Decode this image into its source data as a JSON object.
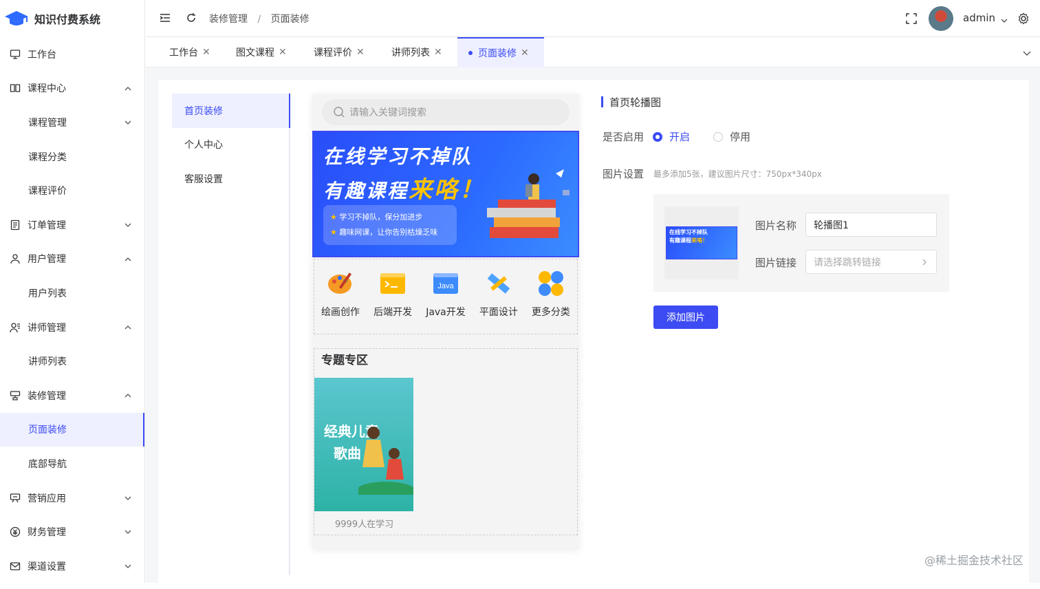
{
  "app": {
    "title": "知识付费系统"
  },
  "sidebar": {
    "items": [
      {
        "label": "工作台",
        "icon": "monitor-icon",
        "type": "top"
      },
      {
        "label": "课程中心",
        "icon": "book-icon",
        "type": "top",
        "arrow": "up"
      },
      {
        "label": "课程管理",
        "type": "sub",
        "arrow": "down"
      },
      {
        "label": "课程分类",
        "type": "sub"
      },
      {
        "label": "课程评价",
        "type": "sub"
      },
      {
        "label": "订单管理",
        "icon": "order-icon",
        "type": "top",
        "arrow": "down"
      },
      {
        "label": "用户管理",
        "icon": "user-icon",
        "type": "top",
        "arrow": "up"
      },
      {
        "label": "用户列表",
        "type": "sub"
      },
      {
        "label": "讲师管理",
        "icon": "lecturer-icon",
        "type": "top",
        "arrow": "up"
      },
      {
        "label": "讲师列表",
        "type": "sub"
      },
      {
        "label": "装修管理",
        "icon": "decor-icon",
        "type": "top",
        "arrow": "up"
      },
      {
        "label": "页面装修",
        "type": "sub",
        "active": true
      },
      {
        "label": "底部导航",
        "type": "sub"
      },
      {
        "label": "营销应用",
        "icon": "marketing-icon",
        "type": "top",
        "arrow": "down"
      },
      {
        "label": "财务管理",
        "icon": "finance-icon",
        "type": "top",
        "arrow": "down"
      },
      {
        "label": "渠道设置",
        "icon": "mail-icon",
        "type": "top",
        "arrow": "down"
      }
    ]
  },
  "header": {
    "breadcrumb": [
      "装修管理",
      "/",
      "页面装修"
    ],
    "user": "admin"
  },
  "tabs": [
    {
      "label": "工作台"
    },
    {
      "label": "图文课程"
    },
    {
      "label": "课程评价"
    },
    {
      "label": "讲师列表"
    },
    {
      "label": "页面装修",
      "active": true
    }
  ],
  "subnav": {
    "items": [
      "首页装修",
      "个人中心",
      "客服设置"
    ]
  },
  "preview": {
    "search_placeholder": "请输入关键词搜索",
    "banner": {
      "line1": "在线学习不掉队",
      "line2a": "有趣课程",
      "line2b": "来咯！",
      "bullet1": "学习不掉队，保分加进步",
      "bullet2": "趣味网课，让你告别枯燥乏味"
    },
    "categories": [
      "绘画创作",
      "后端开发",
      "Java开发",
      "平面设计",
      "更多分类"
    ],
    "java_tag": "Java",
    "topic_title": "专题专区",
    "topic_card": {
      "text1": "经典儿童",
      "text2": "歌曲",
      "learners": "9999人在学习"
    }
  },
  "form": {
    "section_title": "首页轮播图",
    "enable_label": "是否启用",
    "enable_on": "开启",
    "enable_off": "停用",
    "image_label": "图片设置",
    "image_hint": "最多添加5张，建议图片尺寸：750px*340px",
    "name_label": "图片名称",
    "name_value": "轮播图1",
    "link_label": "图片链接",
    "link_placeholder": "请选择跳转链接",
    "add_button": "添加图片",
    "thumb": {
      "line1": "在线学习不掉队",
      "line2a": "有趣课程",
      "line2b": "来咯！"
    }
  },
  "watermark": "@稀土掘金技术社区",
  "colors": {
    "accent": "#3c4bf2",
    "banner": "#2a4dfa",
    "highlight": "#ffb800"
  }
}
